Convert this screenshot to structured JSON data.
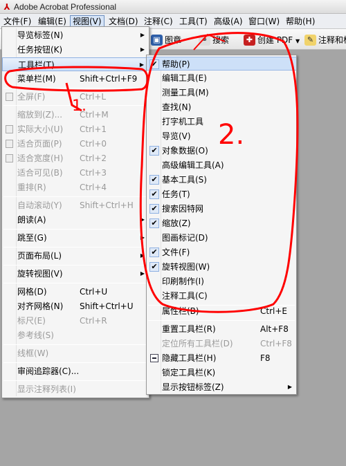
{
  "window": {
    "title": "Adobe Acrobat Professional",
    "icon": "acrobat-icon"
  },
  "menubar": {
    "items": [
      {
        "label": "文件(F)"
      },
      {
        "label": "编辑(E)"
      },
      {
        "label": "视图(V)"
      },
      {
        "label": "文档(D)"
      },
      {
        "label": "注释(C)"
      },
      {
        "label": "工具(T)"
      },
      {
        "label": "高级(A)"
      },
      {
        "label": "窗口(W)"
      },
      {
        "label": "帮助(H)"
      }
    ]
  },
  "toolbar": {
    "stamp": "图章",
    "search": "搜索",
    "create_pdf": "创建 PDF",
    "comment": "注释和标"
  },
  "view_menu": {
    "items": [
      {
        "label": "导览标签(N)",
        "shortcut": ""
      },
      {
        "label": "任务按钮(K)",
        "shortcut": ""
      },
      {
        "label": "工具栏(T)",
        "shortcut": ""
      },
      {
        "label": "菜单栏(M)",
        "shortcut": "Shift+Ctrl+F9"
      },
      {
        "label": "全屏(F)",
        "shortcut": "Ctrl+L"
      },
      {
        "label": "缩放到(Z)...",
        "shortcut": "Ctrl+M"
      },
      {
        "label": "实际大小(U)",
        "shortcut": "Ctrl+1"
      },
      {
        "label": "适合页面(P)",
        "shortcut": "Ctrl+0"
      },
      {
        "label": "适合宽度(H)",
        "shortcut": "Ctrl+2"
      },
      {
        "label": "适合可见(B)",
        "shortcut": "Ctrl+3"
      },
      {
        "label": "重排(R)",
        "shortcut": "Ctrl+4"
      },
      {
        "label": "自动滚动(Y)",
        "shortcut": "Shift+Ctrl+H"
      },
      {
        "label": "朗读(A)",
        "shortcut": ""
      },
      {
        "label": "跳至(G)",
        "shortcut": ""
      },
      {
        "label": "页面布局(L)",
        "shortcut": ""
      },
      {
        "label": "旋转视图(V)",
        "shortcut": ""
      },
      {
        "label": "网格(D)",
        "shortcut": "Ctrl+U"
      },
      {
        "label": "对齐网格(N)",
        "shortcut": "Shift+Ctrl+U"
      },
      {
        "label": "标尺(E)",
        "shortcut": "Ctrl+R"
      },
      {
        "label": "参考线(S)",
        "shortcut": ""
      },
      {
        "label": "线框(W)",
        "shortcut": ""
      },
      {
        "label": "审阅追踪器(C)...",
        "shortcut": ""
      },
      {
        "label": "显示注释列表(I)",
        "shortcut": ""
      }
    ]
  },
  "toolbars_menu": {
    "items": [
      {
        "label": "帮助(P)",
        "shortcut": "",
        "checked": true
      },
      {
        "label": "编辑工具(E)",
        "shortcut": "",
        "checked": false
      },
      {
        "label": "测量工具(M)",
        "shortcut": "",
        "checked": false
      },
      {
        "label": "查找(N)",
        "shortcut": "",
        "checked": false
      },
      {
        "label": "打字机工具",
        "shortcut": "",
        "checked": false
      },
      {
        "label": "导览(V)",
        "shortcut": "",
        "checked": false
      },
      {
        "label": "对象数据(O)",
        "shortcut": "",
        "checked": true
      },
      {
        "label": "高级编辑工具(A)",
        "shortcut": "",
        "checked": false
      },
      {
        "label": "基本工具(S)",
        "shortcut": "",
        "checked": true
      },
      {
        "label": "任务(T)",
        "shortcut": "",
        "checked": true
      },
      {
        "label": "搜索因特网",
        "shortcut": "",
        "checked": true
      },
      {
        "label": "缩放(Z)",
        "shortcut": "",
        "checked": true
      },
      {
        "label": "图画标记(D)",
        "shortcut": "",
        "checked": false
      },
      {
        "label": "文件(F)",
        "shortcut": "",
        "checked": true
      },
      {
        "label": "旋转视图(W)",
        "shortcut": "",
        "checked": true
      },
      {
        "label": "印刷制作(I)",
        "shortcut": "",
        "checked": false
      },
      {
        "label": "注释工具(C)",
        "shortcut": "",
        "checked": false
      },
      {
        "label": "属性栏(B)",
        "shortcut": "Ctrl+E",
        "checked": false
      },
      {
        "label": "重置工具栏(R)",
        "shortcut": "Alt+F8",
        "checked": false
      },
      {
        "label": "定位所有工具栏(D)",
        "shortcut": "Ctrl+F8",
        "checked": false
      },
      {
        "label": "隐藏工具栏(H)",
        "shortcut": "F8",
        "checked": false
      },
      {
        "label": "锁定工具栏(K)",
        "shortcut": "",
        "checked": false
      },
      {
        "label": "显示按钮标签(Z)",
        "shortcut": "",
        "checked": false
      }
    ]
  },
  "annotations": {
    "one": "1.",
    "two": "2."
  },
  "colors": {
    "annotation": "#ff0000",
    "highlight": "#cfe0f7",
    "workspace": "#a5a5a5"
  }
}
